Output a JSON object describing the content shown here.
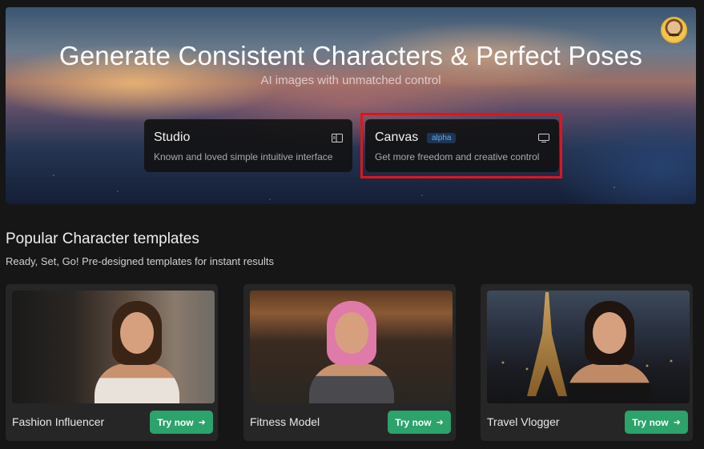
{
  "hero": {
    "title": "Generate Consistent Characters & Perfect Poses",
    "subtitle": "AI images with unmatched control"
  },
  "modes": [
    {
      "title": "Studio",
      "description": "Known and loved simple intuitive interface",
      "icon": "panel-icon"
    },
    {
      "title": "Canvas",
      "badge": "alpha",
      "description": "Get more freedom and creative control",
      "icon": "monitor-icon",
      "highlighted": true
    }
  ],
  "templates_section": {
    "title": "Popular Character templates",
    "subtitle": "Ready, Set, Go! Pre-designed templates for instant results"
  },
  "templates": [
    {
      "name": "Fashion Influencer",
      "button": "Try now"
    },
    {
      "name": "Fitness Model",
      "button": "Try now"
    },
    {
      "name": "Travel Vlogger",
      "button": "Try now"
    }
  ],
  "colors": {
    "background": "#161616",
    "accent_green": "#2ba36a",
    "highlight_red": "#e0141e",
    "badge_blue": "#59a6f2"
  }
}
